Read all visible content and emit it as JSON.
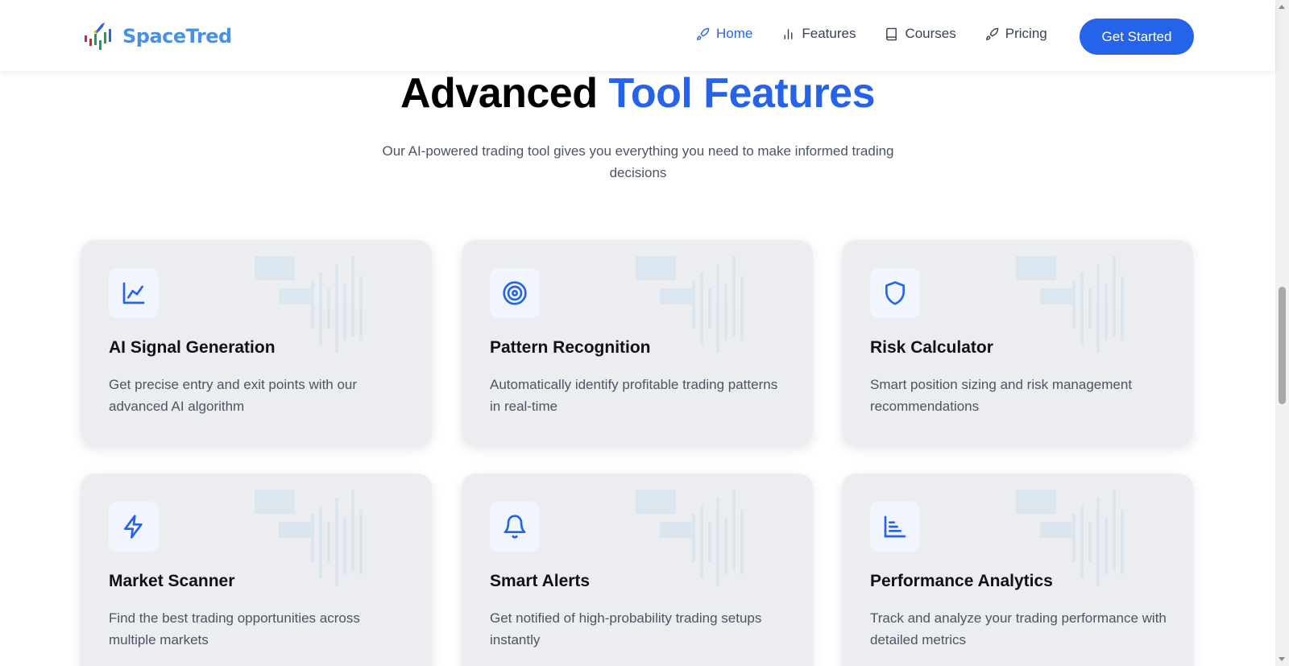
{
  "brand": {
    "name": "SpaceTred"
  },
  "nav": {
    "items": [
      {
        "label": "Home",
        "icon": "rocket-icon",
        "active": true
      },
      {
        "label": "Features",
        "icon": "bar-chart-icon",
        "active": false
      },
      {
        "label": "Courses",
        "icon": "book-icon",
        "active": false
      },
      {
        "label": "Pricing",
        "icon": "rocket-icon",
        "active": false
      }
    ],
    "cta_label": "Get Started"
  },
  "section": {
    "title_main": "Advanced",
    "title_accent": "Tool Features",
    "subtitle": "Our AI-powered trading tool gives you everything you need to make informed trading decisions"
  },
  "features": [
    {
      "title": "AI Signal Generation",
      "desc": "Get precise entry and exit points with our advanced AI algorithm",
      "icon": "line-chart-icon"
    },
    {
      "title": "Pattern Recognition",
      "desc": "Automatically identify profitable trading patterns in real-time",
      "icon": "target-icon"
    },
    {
      "title": "Risk Calculator",
      "desc": "Smart position sizing and risk management recommendations",
      "icon": "shield-icon"
    },
    {
      "title": "Market Scanner",
      "desc": "Find the best trading opportunities across multiple markets",
      "icon": "lightning-icon"
    },
    {
      "title": "Smart Alerts",
      "desc": "Get notified of high-probability trading setups instantly",
      "icon": "bell-icon"
    },
    {
      "title": "Performance Analytics",
      "desc": "Track and analyze your trading performance with detailed metrics",
      "icon": "analytics-icon"
    }
  ],
  "colors": {
    "accent": "#2563eb",
    "logo": "#4a90e2",
    "card_bg": "#ebedf0"
  }
}
